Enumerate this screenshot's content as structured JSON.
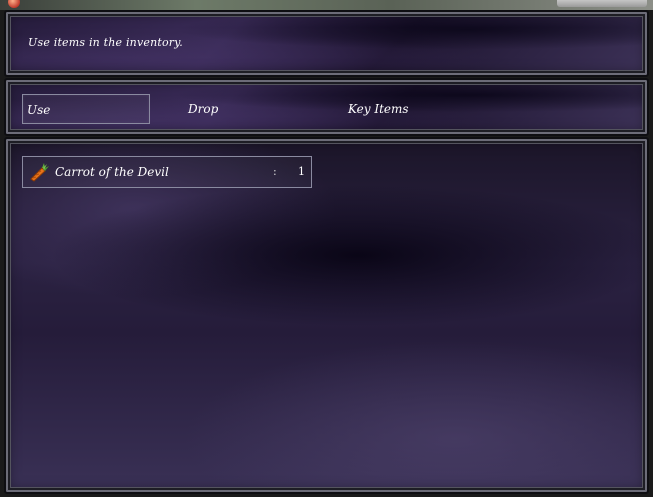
{
  "help": {
    "text": "Use items in the inventory."
  },
  "commands": [
    {
      "label": "Use",
      "selected": true
    },
    {
      "label": "Drop",
      "selected": false
    },
    {
      "label": "Key Items",
      "selected": false
    }
  ],
  "items": [
    {
      "name": "Carrot of the Devil",
      "separator": ":",
      "quantity": "1",
      "icon": "carrot-icon"
    }
  ]
}
